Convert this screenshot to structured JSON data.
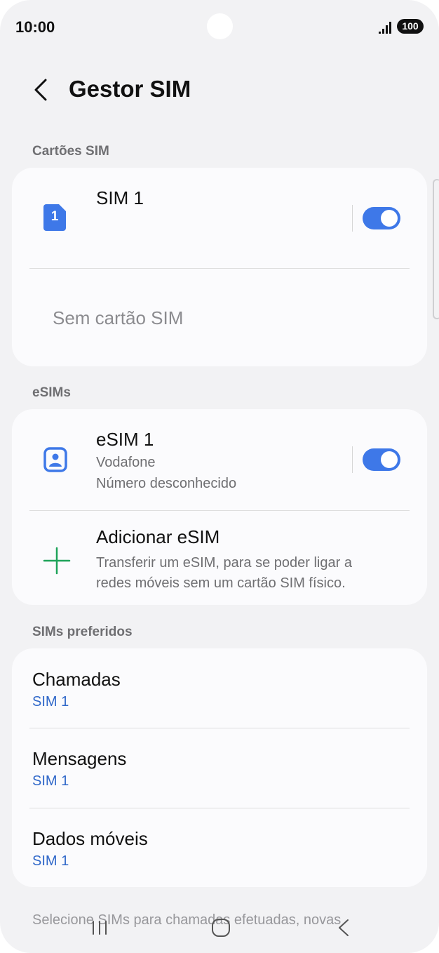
{
  "status_bar": {
    "time": "10:00",
    "battery": "100"
  },
  "header": {
    "title": "Gestor SIM"
  },
  "sections": {
    "sim_cards": "Cartões SIM",
    "esims": "eSIMs",
    "preferred": "SIMs preferidos"
  },
  "sim_cards": {
    "sim1": {
      "badge": "1",
      "title": "SIM 1",
      "enabled": true
    },
    "empty_slot": "Sem cartão SIM"
  },
  "esims": {
    "esim1": {
      "title": "eSIM 1",
      "operator": "Vodafone",
      "number": "Número desconhecido",
      "enabled": true
    },
    "add": {
      "title": "Adicionar eSIM",
      "description_line1": "Transferir um eSIM, para se poder ligar a",
      "description_line2": "redes móveis sem um cartão SIM físico."
    }
  },
  "preferred": {
    "calls": {
      "title": "Chamadas",
      "value": "SIM 1"
    },
    "messages": {
      "title": "Mensagens",
      "value": "SIM 1"
    },
    "mobile_data": {
      "title": "Dados móveis",
      "value": "SIM 1"
    }
  },
  "footer": {
    "text": "Selecione SIMs para chamadas efetuadas, novas"
  },
  "colors": {
    "accent": "#3e78e8",
    "add_icon": "#1ea35a",
    "link_blue": "#3068c9"
  },
  "icons": {
    "back": "chevron-left-icon",
    "sim": "sim-card-icon",
    "esim": "esim-contact-icon",
    "add": "plus-icon",
    "signal": "signal-icon",
    "battery": "battery-icon"
  }
}
